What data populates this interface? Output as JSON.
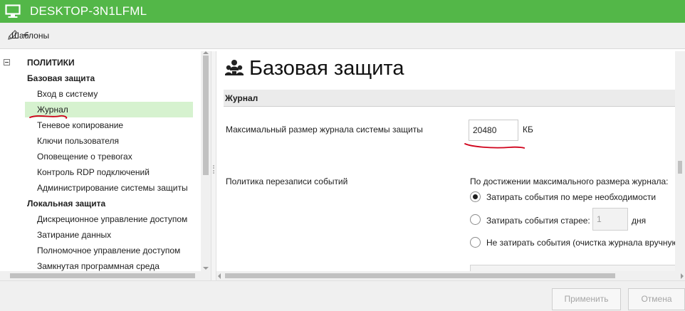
{
  "window": {
    "title": "DESKTOP-3N1LFML",
    "accent": "#53b748",
    "icon": "monitor-icon"
  },
  "toolbar": {
    "templates_label": "Шаблоны",
    "templates_icon": "pencil-icon"
  },
  "tree": {
    "root_label": "ПОЛИТИКИ",
    "sections": [
      {
        "label": "Базовая защита",
        "items": [
          "Вход в систему",
          "Журнал",
          "Теневое копирование",
          "Ключи пользователя",
          "Оповещение о тревогах",
          "Контроль RDP подключений",
          "Администрирование системы защиты"
        ]
      },
      {
        "label": "Локальная защита",
        "items": [
          "Дискреционное управление доступом",
          "Затирание данных",
          "Полномочное управление доступом",
          "Замкнутая программная среда"
        ]
      }
    ],
    "selected_item": "Журнал",
    "selected_color": "#d6f2cf"
  },
  "page": {
    "title": "Базовая защита",
    "title_icon": "agents-icon",
    "group_header": "Журнал",
    "max_size": {
      "label": "Максимальный размер журнала системы защиты",
      "value": "20480",
      "unit": "КБ"
    },
    "overwrite": {
      "label": "Политика перезаписи событий",
      "caption": "По достижении максимального размера журнала:",
      "options": [
        {
          "label": "Затирать события по мере необходимости",
          "checked": true
        },
        {
          "label": "Затирать события старее:",
          "checked": false,
          "days_value": "1",
          "days_unit": "дня"
        },
        {
          "label": "Не затирать события (очистка журнала вручную)",
          "checked": false
        }
      ]
    }
  },
  "buttons": {
    "apply": "Применить",
    "cancel": "Отмена"
  },
  "annotation_color": "#d0021b"
}
